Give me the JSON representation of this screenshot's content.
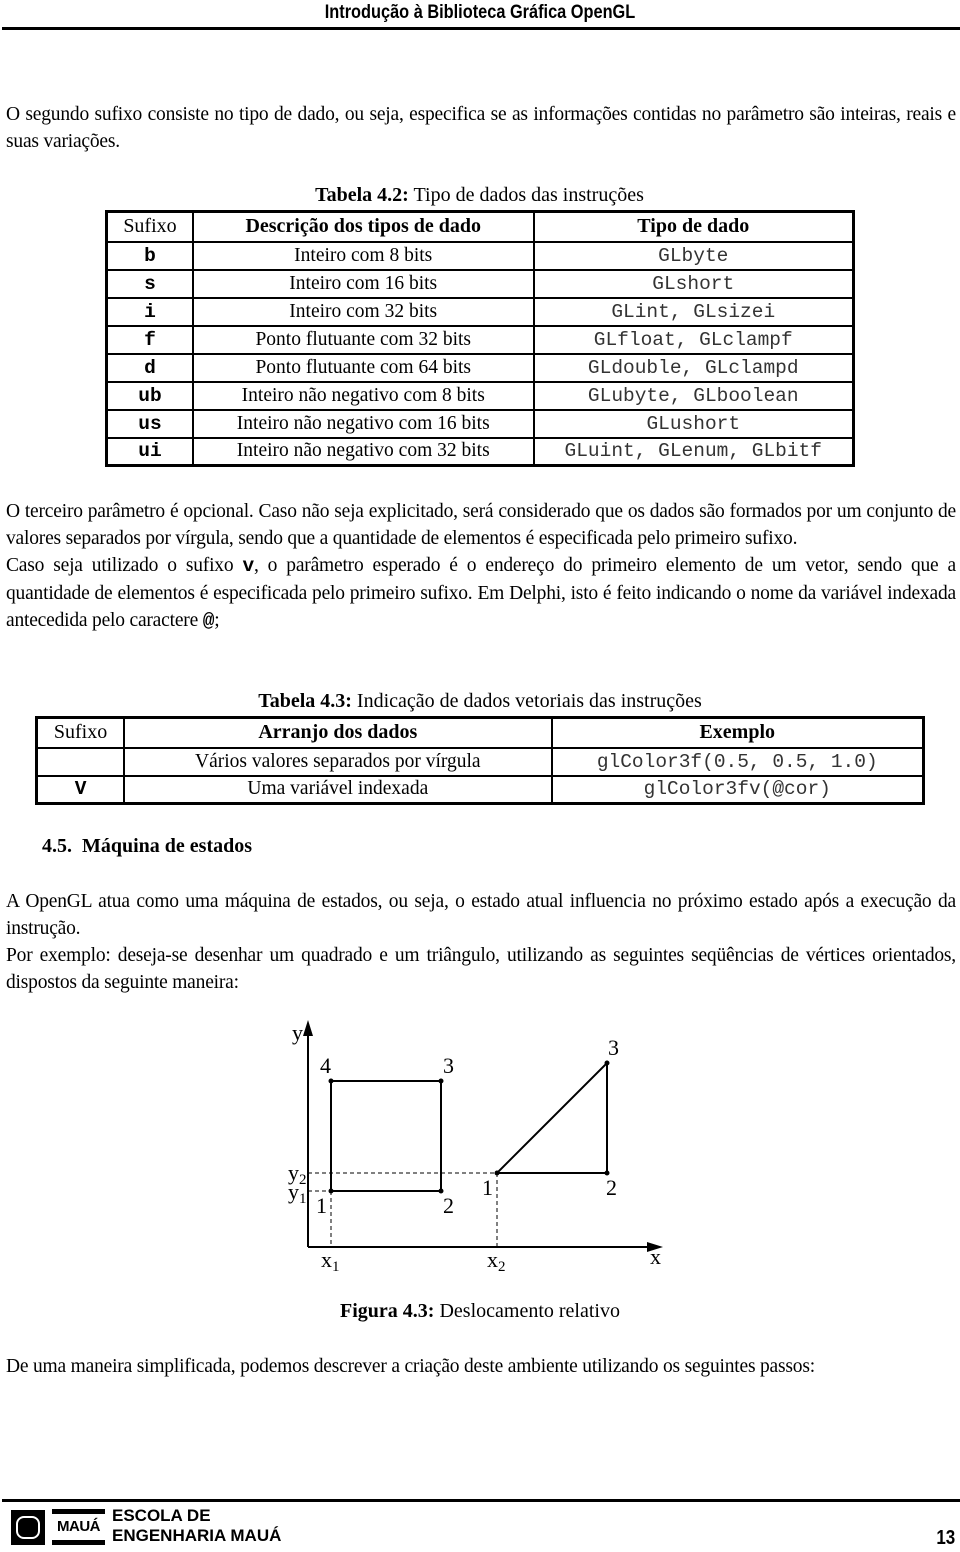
{
  "header": {
    "title": "Introdução à Biblioteca Gráfica OpenGL"
  },
  "intro_paragraph": "O segundo sufixo consiste no tipo de dado, ou seja, especifica se as informações contidas no parâmetro são inteiras, reais e suas variações.",
  "table_4_2": {
    "caption_label": "Tabela 4.2:",
    "caption_text": " Tipo de dados das instruções",
    "headers": [
      "Sufixo",
      "Descrição dos tipos de dado",
      "Tipo de dado"
    ],
    "rows": [
      {
        "suffix": "b",
        "description": "Inteiro com 8 bits",
        "type": "GLbyte"
      },
      {
        "suffix": "s",
        "description": "Inteiro com 16 bits",
        "type": "GLshort"
      },
      {
        "suffix": "i",
        "description": "Inteiro com 32 bits",
        "type": "GLint, GLsizei"
      },
      {
        "suffix": "f",
        "description": "Ponto flutuante com 32 bits",
        "type": "GLfloat, GLclampf"
      },
      {
        "suffix": "d",
        "description": "Ponto flutuante com 64 bits",
        "type": "GLdouble, GLclampd"
      },
      {
        "suffix": "ub",
        "description": "Inteiro não negativo com 8 bits",
        "type": "GLubyte, GLboolean"
      },
      {
        "suffix": "us",
        "description": "Inteiro não negativo com 16 bits",
        "type": "GLushort"
      },
      {
        "suffix": "ui",
        "description": "Inteiro não negativo com 32 bits",
        "type": "GLuint, GLenum, GLbitf"
      }
    ]
  },
  "third_param": {
    "p1": "O terceiro parâmetro é opcional. Caso não seja explicitado, será considerado que os dados são formados por um conjunto de valores separados por vírgula, sendo que a quantidade de elementos é especificada pelo primeiro sufixo.",
    "p2_before": "Caso seja utilizado o sufixo ",
    "p2_code": "v",
    "p2_after": ", o parâmetro esperado é o endereço do primeiro elemento de um vetor, sendo que a quantidade de elementos é especificada pelo primeiro sufixo. Em Delphi, isto é feito indicando o nome da variável indexada antecedida pelo caractere ",
    "p2_char": "@",
    "p2_end": ";"
  },
  "table_4_3": {
    "caption_label": "Tabela 4.3:",
    "caption_text": " Indicação de dados vetoriais das instruções",
    "headers": [
      "Sufixo",
      "Arranjo dos dados",
      "Exemplo"
    ],
    "rows": [
      {
        "suffix": "",
        "arrangement": "Vários valores separados por vírgula",
        "example": "glColor3f(0.5, 0.5, 1.0)"
      },
      {
        "suffix": "V",
        "arrangement": "Uma variável indexada",
        "example": "glColor3fv(@cor)"
      }
    ]
  },
  "section": {
    "number": "4.5.",
    "title": "Máquina de estados"
  },
  "state_machine": {
    "p1": "A OpenGL atua como uma máquina de estados, ou seja, o estado atual influencia no próximo estado após a execução da instrução.",
    "p2": "Por exemplo: deseja-se desenhar um quadrado e um triângulo, utilizando as seguintes seqüências de vértices orientados, dispostos da seguinte maneira:"
  },
  "figure": {
    "axis_y_label": "y",
    "axis_x_label": "x",
    "y2_label": "y",
    "y2_sub": "2",
    "y1_label": "y",
    "y1_sub": "1",
    "x1_label": "x",
    "x1_sub": "1",
    "x2_label": "x",
    "x2_sub": "2",
    "square_vertex_labels": [
      "1",
      "2",
      "3",
      "4"
    ],
    "triangle_vertex_labels": [
      "1",
      "2",
      "3"
    ],
    "caption_label": "Figura 4.3:",
    "caption_text": " Deslocamento relativo"
  },
  "closing_paragraph": "De uma maneira simplificada, podemos descrever a criação deste ambiente utilizando os seguintes passos:",
  "footer": {
    "logo_word": "MAUÁ",
    "school_line1": "ESCOLA DE",
    "school_line2": "ENGENHARIA MAUÁ",
    "page_number": "13"
  }
}
